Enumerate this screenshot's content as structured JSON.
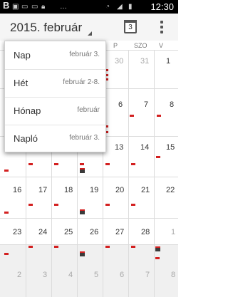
{
  "statusbar": {
    "time": "12:30",
    "icons": [
      "b-icon",
      "image-icon",
      "chat-icon",
      "chat-icon",
      "lock-icon",
      "wifi-icon",
      "signal-icon",
      "battery-icon"
    ]
  },
  "actionbar": {
    "title": "2015. február",
    "today_number": "3"
  },
  "weekday_headers": [
    "P",
    "SZO",
    "V"
  ],
  "dropdown": {
    "items": [
      {
        "label": "Nap",
        "sub": "február 3."
      },
      {
        "label": "Hét",
        "sub": "február 2-8."
      },
      {
        "label": "Hónap",
        "sub": "február"
      },
      {
        "label": "Napló",
        "sub": "február 3."
      }
    ]
  },
  "weeks": [
    [
      "",
      "",
      "",
      "",
      "30",
      "31",
      "1"
    ],
    [
      "",
      "",
      "",
      "",
      "6",
      "7",
      "8"
    ],
    [
      "",
      "",
      "",
      "",
      "13",
      "14",
      "15"
    ],
    [
      "16",
      "17",
      "18",
      "19",
      "20",
      "21",
      "22"
    ],
    [
      "23",
      "24",
      "25",
      "26",
      "27",
      "28",
      "1"
    ],
    [
      "2",
      "3",
      "4",
      "5",
      "6",
      "7",
      "8"
    ]
  ],
  "colors": {
    "event": "#d32020",
    "statusbar": "#000000",
    "actionbar": "#f5f5f5"
  }
}
